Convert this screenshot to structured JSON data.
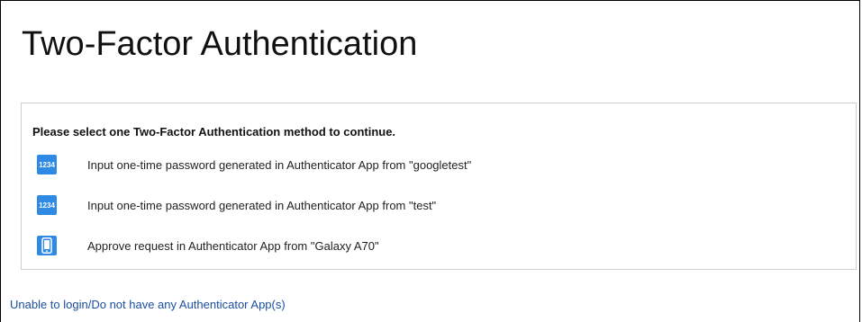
{
  "page": {
    "title": "Two-Factor Authentication"
  },
  "methods_panel": {
    "heading": "Please select one Two-Factor Authentication method to continue.",
    "methods": [
      {
        "icon": "otp-code-icon",
        "icon_text": "1234",
        "label": "Input one-time password generated in Authenticator App from \"googletest\""
      },
      {
        "icon": "otp-code-icon",
        "icon_text": "1234",
        "label": "Input one-time password generated in Authenticator App from \"test\""
      },
      {
        "icon": "mobile-phone-icon",
        "label": "Approve request in Authenticator App from \"Galaxy A70\""
      }
    ]
  },
  "fallback_link": {
    "label": "Unable to login/Do not have any Authenticator App(s)"
  },
  "colors": {
    "icon_background": "#2f8ae6",
    "link": "#1a4fa0",
    "panel_border": "#cfcfcf"
  }
}
